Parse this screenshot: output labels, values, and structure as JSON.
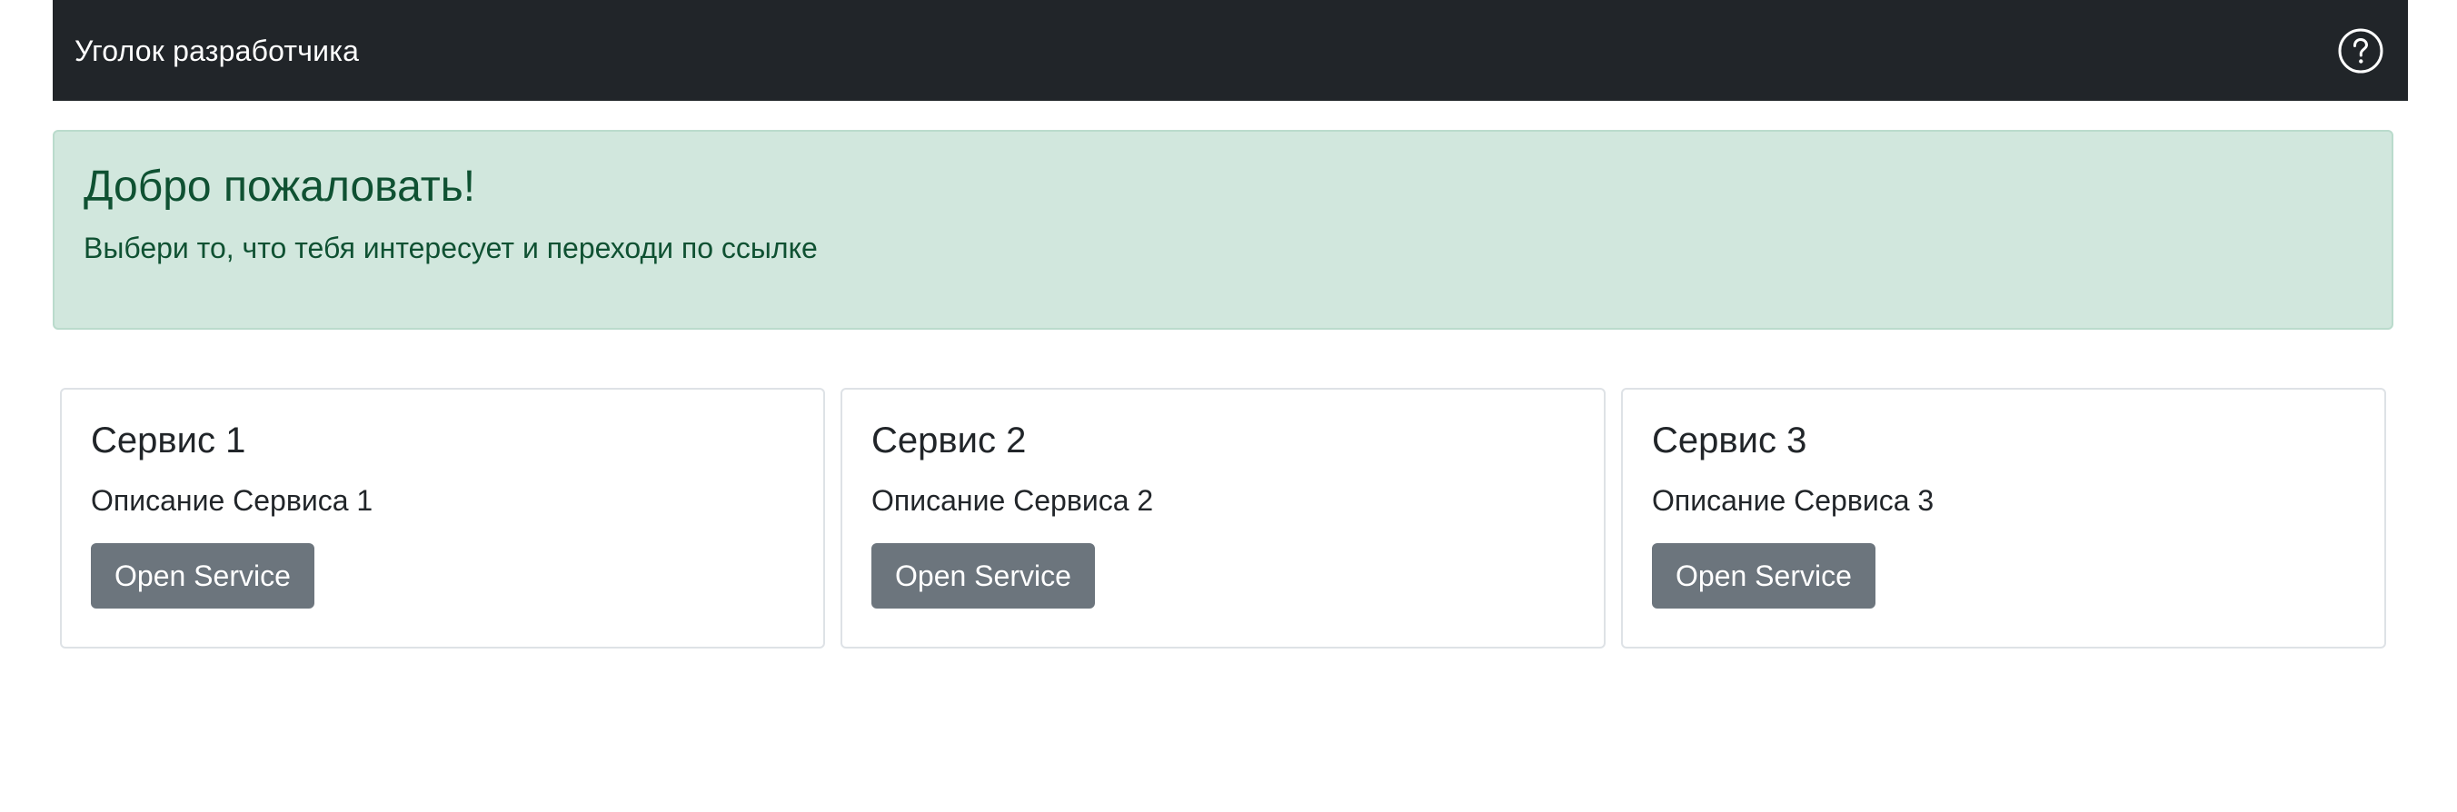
{
  "navbar": {
    "brand": "Уголок разработчика",
    "help_icon": "question-circle-icon"
  },
  "alert": {
    "heading": "Добро пожаловать!",
    "text": "Выбери то, что тебя интересует и переходи по ссылке"
  },
  "services": [
    {
      "title": "Сервис 1",
      "description": "Описание Сервиса 1",
      "button_label": "Open Service"
    },
    {
      "title": "Сервис 2",
      "description": "Описание Сервиса 2",
      "button_label": "Open Service"
    },
    {
      "title": "Сервис 3",
      "description": "Описание Сервиса 3",
      "button_label": "Open Service"
    }
  ],
  "colors": {
    "navbar_bg": "#212529",
    "alert_bg": "#d1e7dd",
    "alert_text": "#0f5132",
    "button_bg": "#6c757d"
  }
}
